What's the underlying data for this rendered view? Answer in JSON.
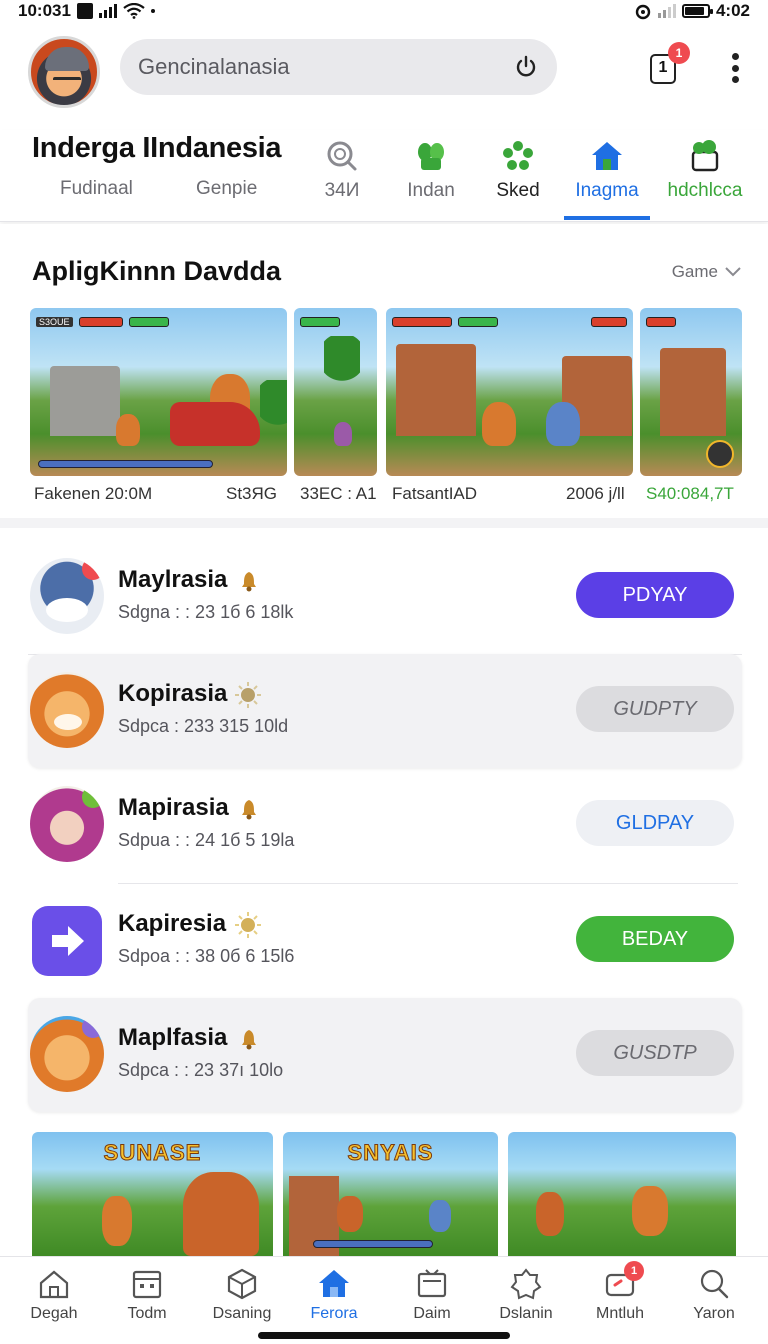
{
  "status_bar": {
    "time_left": "10:031",
    "time_right": "4:02"
  },
  "header": {
    "search_value": "Gencinalanasia",
    "notification_count": "1",
    "notification_box_label": "1"
  },
  "title_row": {
    "title": "Inderga IIndanesia",
    "sub_tabs": [
      "Fudinaal",
      "Genpie"
    ],
    "icon_tabs": [
      {
        "label": "34И",
        "icon": "search-icon"
      },
      {
        "label": "Indan",
        "icon": "leaf-icon"
      },
      {
        "label": "Sked",
        "icon": "flower-icon"
      },
      {
        "label": "Inagma",
        "icon": "home-icon",
        "active": true
      },
      {
        "label": "hdchlcca",
        "icon": "gift-icon"
      }
    ],
    "accent_color": "#1f6fe3"
  },
  "featured": {
    "title": "ApligKinnn Davdda",
    "dropdown_label": "Game",
    "captions": [
      {
        "text": "Fakenen 20:0M"
      },
      {
        "text": "St3ЯG"
      },
      {
        "text": "33EC : A1"
      },
      {
        "text": "FatsantIAD"
      },
      {
        "text": "2006 j/ll"
      },
      {
        "text": "S40:084,7T",
        "color": "#3aa63a"
      }
    ],
    "shot_badge": "S3OUE"
  },
  "apps": [
    {
      "name": "Maylrasia",
      "sub": "Sdgna : : 23 1б 6 18lk",
      "button": "PDYAY",
      "button_style": "purple",
      "marker": "bell"
    },
    {
      "name": "Kopirasia",
      "sub": "Sdpca : 233 315 10ld",
      "button": "GUDPTY",
      "button_style": "gray",
      "marker": "sun"
    },
    {
      "name": "Mapirasia",
      "sub": "Sdpua : : 24 1б 5 19la",
      "button": "GLDPAY",
      "button_style": "light",
      "marker": "bell"
    },
    {
      "name": "Kapiresia",
      "sub": "Sdpoa : : 38 0б 6 15l6",
      "button": "BEDAY",
      "button_style": "green",
      "marker": "sun"
    },
    {
      "name": "Maplfasia",
      "sub": "Sdpca : : 23 37ı 10lo",
      "button": "GUSDTP",
      "button_style": "gray",
      "marker": "bell"
    }
  ],
  "banners": [
    {
      "title": "SUNASE"
    },
    {
      "title": "SNYAIS"
    },
    {
      "title": ""
    }
  ],
  "bottom_nav": [
    {
      "label": "Degah",
      "icon": "home-outline-icon"
    },
    {
      "label": "Todm",
      "icon": "calendar-icon"
    },
    {
      "label": "Dsaning",
      "icon": "cube-icon"
    },
    {
      "label": "Ferora",
      "icon": "home-filled-icon",
      "active": true
    },
    {
      "label": "Daim",
      "icon": "tv-icon"
    },
    {
      "label": "Dslanin",
      "icon": "badge-icon"
    },
    {
      "label": "Mntluh",
      "icon": "message-icon",
      "badge": "1"
    },
    {
      "label": "Yaron",
      "icon": "search-icon"
    }
  ]
}
